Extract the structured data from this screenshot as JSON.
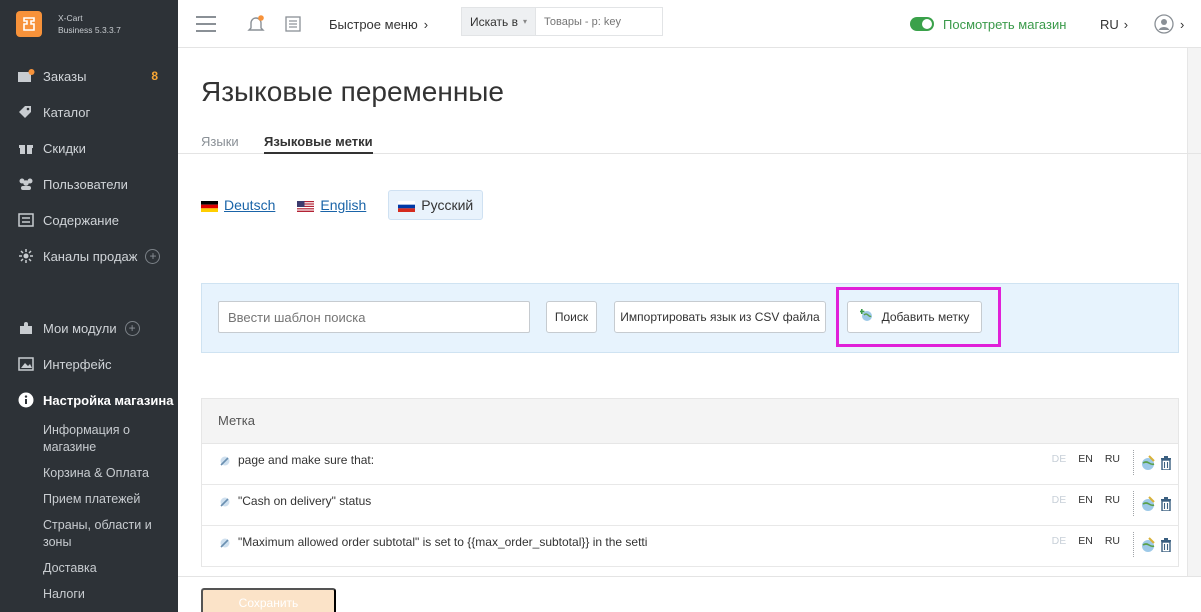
{
  "brand": {
    "name": "X-Cart",
    "edition": "Business 5.3.3.7"
  },
  "sidebar": {
    "items": [
      {
        "label": "Заказы",
        "icon": "orders-icon",
        "badge": "8"
      },
      {
        "label": "Каталог",
        "icon": "tag-icon"
      },
      {
        "label": "Скидки",
        "icon": "gift-icon"
      },
      {
        "label": "Пользователи",
        "icon": "users-icon"
      },
      {
        "label": "Содержание",
        "icon": "content-icon"
      },
      {
        "label": "Каналы продаж",
        "icon": "channels-icon"
      },
      {
        "label": "Мои модули",
        "icon": "puzzle-icon"
      },
      {
        "label": "Интерфейс",
        "icon": "image-icon"
      },
      {
        "label": "Настройка магазина",
        "icon": "info-icon"
      }
    ],
    "subitems": [
      "Информация о магазине",
      "Корзина & Оплата",
      "Прием платежей",
      "Страны, области и зоны",
      "Доставка",
      "Налоги"
    ]
  },
  "topbar": {
    "quick_menu": "Быстрое меню",
    "search_scope": "Искать в",
    "search_placeholder": "Товары - р: key",
    "storefront": "Посмотреть магазин",
    "language": "RU"
  },
  "page": {
    "title": "Языковые переменные",
    "tabs": [
      "Языки",
      "Языковые метки"
    ]
  },
  "languages": [
    {
      "label": "Deutsch",
      "code": "de"
    },
    {
      "label": "English",
      "code": "en"
    },
    {
      "label": "Русский",
      "code": "ru"
    }
  ],
  "search": {
    "placeholder": "Ввести шаблон поиска",
    "search_button": "Поиск",
    "import_button": "Импортировать язык из CSV файла",
    "add_button": "Добавить метку"
  },
  "table": {
    "header": "Метка",
    "codes": [
      "DE",
      "EN",
      "RU"
    ],
    "rows": [
      "page and make sure that:",
      "\"Cash on delivery\" status",
      "\"Maximum allowed order subtotal\" is set to {{max_order_subtotal}} in the setti"
    ]
  },
  "footer": {
    "save_button": "Сохранить"
  },
  "colors": {
    "sidebar_bg": "#2d3237",
    "brand_orange": "#f7923a",
    "badge": "#f7a534",
    "storefront_green": "#3aa14a",
    "link_blue": "#1a64a8",
    "search_panel_bg": "#e7f3fd",
    "highlight_magenta": "#e020d8",
    "save_disabled": "#fbe3c8"
  }
}
